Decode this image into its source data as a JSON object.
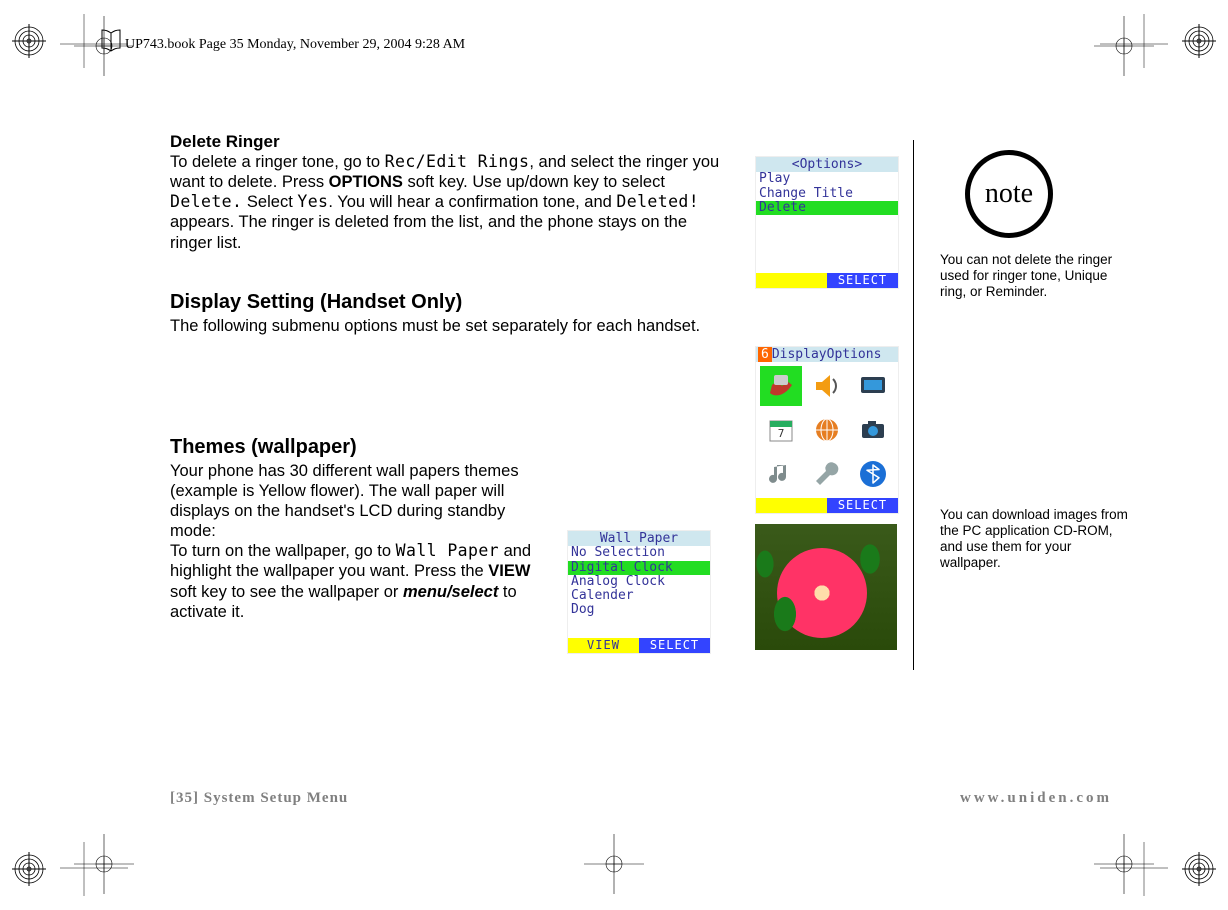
{
  "header": {
    "framemaker_line": "UP743.book  Page 35  Monday, November 29, 2004  9:28 AM"
  },
  "section1": {
    "heading": "Delete Ringer",
    "para_a": "To delete a ringer tone, go to ",
    "menu_a": "Rec/Edit Rings",
    "para_b": ", and select the ringer you want to delete. Press ",
    "bold_options": "OPTIONS",
    "para_c": " soft key. Use up/down key to select ",
    "menu_b": "Delete.",
    "para_d": " Select ",
    "menu_c": "Yes",
    "para_e": ". You will hear a confirmation tone, and ",
    "menu_d": "Deleted!",
    "para_f": " appears. The ringer is deleted from the list, and the phone stays on the ringer list."
  },
  "section2": {
    "heading": "Display Setting (Handset Only)",
    "para": "The following submenu options must be set separately for each handset."
  },
  "section3": {
    "heading": "Themes (wallpaper)",
    "para_a": "Your phone has 30 different wall papers themes (example is Yellow flower). The wall paper will displays on the handset's LCD during standby mode:",
    "para_b_a": "To turn on the wallpaper, go to ",
    "menu_a": "Wall Paper",
    "para_b_b": " and highlight the wallpaper you want. Press the ",
    "bold_view": "VIEW",
    "para_b_c": " soft key to see the wallpaper or ",
    "bold_ital": "menu/select",
    "para_b_d": " to activate it."
  },
  "lcd_options": {
    "title": "<Options>",
    "items": [
      "Play",
      "Change Title",
      "Delete"
    ],
    "selected_index": 2,
    "soft_right": "SELECT"
  },
  "lcd_display": {
    "title_num": "6",
    "title": "DisplayOptions",
    "soft_right": "SELECT"
  },
  "lcd_wallpaper": {
    "title": "Wall Paper",
    "items": [
      "No Selection",
      "Digital Clock",
      "Analog Clock",
      "Calender",
      "Dog"
    ],
    "selected_index": 1,
    "soft_left": "VIEW",
    "soft_right": "SELECT"
  },
  "sidebar": {
    "note_label": "note",
    "note1": "You can not delete the ringer used for ringer tone, Unique ring, or Reminder.",
    "note2": "You can download images from the PC application CD-ROM, and use them for your wallpaper."
  },
  "footer": {
    "left": "[35] System Setup Menu",
    "right": "www.uniden.com"
  }
}
